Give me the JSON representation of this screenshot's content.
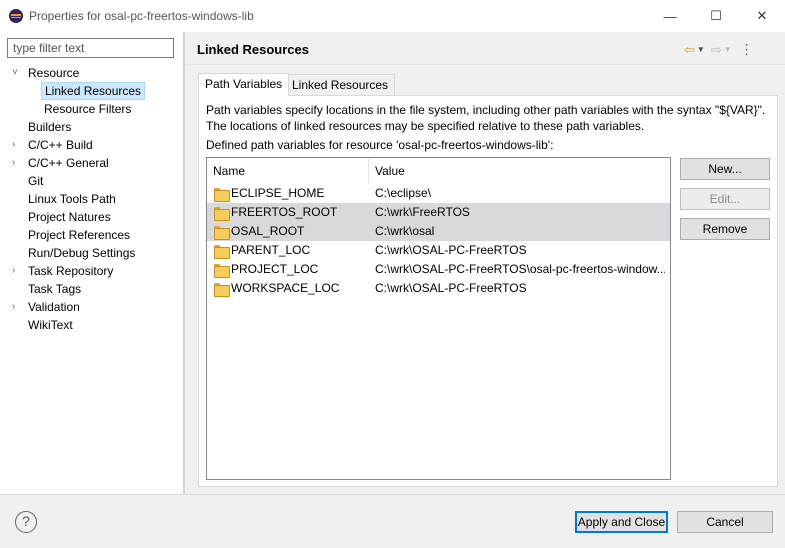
{
  "window": {
    "title": "Properties for osal-pc-freertos-windows-lib",
    "minimize": "—",
    "maximize": "☐",
    "close": "✕"
  },
  "sidebar": {
    "filter_placeholder": "type filter text",
    "items": [
      {
        "label": "Resource",
        "arrow": "˅",
        "level": 0
      },
      {
        "label": "Linked Resources",
        "arrow": "",
        "level": 1,
        "selected": true
      },
      {
        "label": "Resource Filters",
        "arrow": "",
        "level": 1
      },
      {
        "label": "Builders",
        "arrow": "",
        "level": 0
      },
      {
        "label": "C/C++ Build",
        "arrow": "›",
        "level": 0
      },
      {
        "label": "C/C++ General",
        "arrow": "›",
        "level": 0
      },
      {
        "label": "Git",
        "arrow": "",
        "level": 0
      },
      {
        "label": "Linux Tools Path",
        "arrow": "",
        "level": 0
      },
      {
        "label": "Project Natures",
        "arrow": "",
        "level": 0
      },
      {
        "label": "Project References",
        "arrow": "",
        "level": 0
      },
      {
        "label": "Run/Debug Settings",
        "arrow": "",
        "level": 0
      },
      {
        "label": "Task Repository",
        "arrow": "›",
        "level": 0
      },
      {
        "label": "Task Tags",
        "arrow": "",
        "level": 0
      },
      {
        "label": "Validation",
        "arrow": "›",
        "level": 0
      },
      {
        "label": "WikiText",
        "arrow": "",
        "level": 0
      }
    ]
  },
  "header": {
    "title": "Linked Resources",
    "back_icon": "⇦",
    "forward_icon": "⇨",
    "menu_icon": "⋮",
    "dropdown_icon": "▼"
  },
  "tabs": [
    {
      "label": "Path Variables",
      "active": true
    },
    {
      "label": "Linked Resources",
      "active": false
    }
  ],
  "main": {
    "description_line1": "Path variables specify locations in the file system, including other path variables with the syntax \"${VAR}\".",
    "description_line2": "The locations of linked resources may be specified relative to these path variables.",
    "defined_label": "Defined path variables for resource 'osal-pc-freertos-windows-lib':",
    "columns": [
      "Name",
      "Value"
    ],
    "rows": [
      {
        "name": "ECLIPSE_HOME",
        "value": "C:\\eclipse\\",
        "selected": false
      },
      {
        "name": "FREERTOS_ROOT",
        "value": "C:\\wrk\\FreeRTOS",
        "selected": true
      },
      {
        "name": "OSAL_ROOT",
        "value": "C:\\wrk\\osal",
        "selected": true
      },
      {
        "name": "PARENT_LOC",
        "value": "C:\\wrk\\OSAL-PC-FreeRTOS",
        "selected": false
      },
      {
        "name": "PROJECT_LOC",
        "value": "C:\\wrk\\OSAL-PC-FreeRTOS\\osal-pc-freertos-window...",
        "selected": false
      },
      {
        "name": "WORKSPACE_LOC",
        "value": "C:\\wrk\\OSAL-PC-FreeRTOS",
        "selected": false
      }
    ],
    "buttons": {
      "new": "New...",
      "edit": "Edit...",
      "remove": "Remove"
    }
  },
  "footer": {
    "help_icon": "?",
    "apply_close": "Apply and Close",
    "cancel": "Cancel"
  }
}
